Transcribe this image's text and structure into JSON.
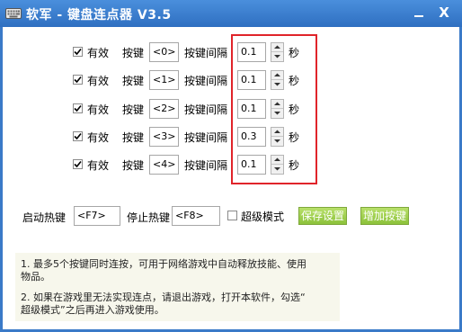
{
  "window": {
    "title": "软军 - 键盘连点器 V3.5",
    "minimize": "–",
    "close": "X"
  },
  "rows": [
    {
      "enabled_label": "有效",
      "enabled": true,
      "key_label": "按键",
      "key": "<0>",
      "interval_label": "按键间隔",
      "interval": "0.1",
      "unit": "秒"
    },
    {
      "enabled_label": "有效",
      "enabled": true,
      "key_label": "按键",
      "key": "<1>",
      "interval_label": "按键间隔",
      "interval": "0.1",
      "unit": "秒"
    },
    {
      "enabled_label": "有效",
      "enabled": true,
      "key_label": "按键",
      "key": "<2>",
      "interval_label": "按键间隔",
      "interval": "0.1",
      "unit": "秒"
    },
    {
      "enabled_label": "有效",
      "enabled": true,
      "key_label": "按键",
      "key": "<3>",
      "interval_label": "按键间隔",
      "interval": "0.3",
      "unit": "秒"
    },
    {
      "enabled_label": "有效",
      "enabled": true,
      "key_label": "按键",
      "key": "<4>",
      "interval_label": "按键间隔",
      "interval": "0.1",
      "unit": "秒"
    }
  ],
  "bottom": {
    "start_hotkey_label": "启动热键",
    "start_hotkey": "<F7>",
    "stop_hotkey_label": "停止热键",
    "stop_hotkey": "<F8>",
    "super_mode_label": "超级模式",
    "super_mode": false,
    "save_button": "保存设置",
    "add_button": "增加按键"
  },
  "info": {
    "line1": "1. 最多5个按键同时连按，可用于网络游戏中自动释放技能、使用",
    "line2": "物品。",
    "line3": "2. 如果在游戏里无法实现连点，请退出游戏，打开本软件，勾选“",
    "line4": "超级模式”之后再进入游戏使用。"
  },
  "colors": {
    "title_bar": "#3a7ac8",
    "highlight_frame": "#e0242a",
    "green_button": "#8cc23a",
    "info_bg": "#f7f7ec"
  }
}
